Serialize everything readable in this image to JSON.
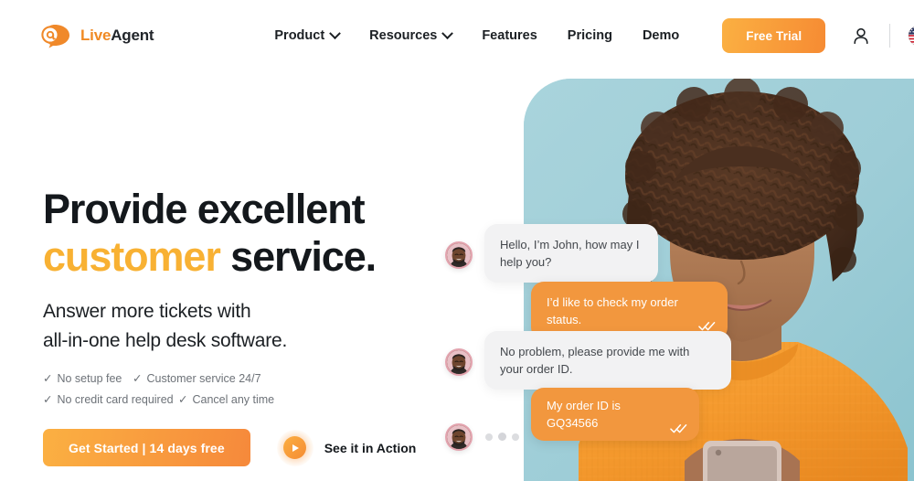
{
  "brand": {
    "logo_icon": "at-speech-bubble-icon",
    "name_primary": "Live",
    "name_secondary": "Agent"
  },
  "header": {
    "nav": [
      {
        "label": "Product",
        "has_dropdown": true,
        "icon": "chevron-down-icon"
      },
      {
        "label": "Resources",
        "has_dropdown": true,
        "icon": "chevron-down-icon"
      },
      {
        "label": "Features",
        "has_dropdown": false,
        "icon": ""
      },
      {
        "label": "Pricing",
        "has_dropdown": false,
        "icon": ""
      },
      {
        "label": "Demo",
        "has_dropdown": false,
        "icon": ""
      }
    ],
    "free_trial_label": "Free Trial",
    "account_icon": "user-icon",
    "language": {
      "flag_icon": "us-flag-icon",
      "chevron_icon": "chevron-down-icon"
    }
  },
  "hero": {
    "headline_line1_a": "Provide excellent",
    "headline_line2_accent": "customer",
    "headline_line2_b": " service.",
    "subhead_line1": "Answer more tickets with",
    "subhead_line2": "all-in-one help desk software.",
    "perks": [
      {
        "tick": "✓",
        "label": "No setup fee"
      },
      {
        "tick": "✓",
        "label": "Customer service 24/7"
      },
      {
        "tick": "✓",
        "label": "No credit card required"
      },
      {
        "tick": "✓",
        "label": "Cancel any time"
      }
    ],
    "cta_primary": "Get Started | 14 days free",
    "cta_secondary": "See it in Action",
    "play_icon": "play-icon",
    "image_alt": "woman-with-curly-hair-in-orange-sweater-holding-phone"
  },
  "chat": {
    "messages": [
      {
        "from": "agent",
        "text": "Hello, I’m John, how may I help you?",
        "avatar_icon": "agent-avatar",
        "read_receipt": false
      },
      {
        "from": "user",
        "text": "I’d like to check my order status.",
        "read_receipt": true,
        "receipt_icon": "double-check-icon"
      },
      {
        "from": "agent",
        "text": "No problem, please provide me with your order ID.",
        "avatar_icon": "agent-avatar",
        "read_receipt": false
      },
      {
        "from": "user",
        "text": "My order ID is GQ34566",
        "read_receipt": true,
        "receipt_icon": "double-check-icon"
      },
      {
        "from": "agent",
        "text": "",
        "avatar_icon": "agent-avatar",
        "typing": true,
        "typing_icon": "typing-dots-icon"
      }
    ]
  },
  "colors": {
    "brand_orange": "#F08A24",
    "accent_yellow": "#F8B133",
    "cta_gradient_start": "#FBB042",
    "cta_gradient_end": "#F6893B",
    "hero_bg": "#a6d2da",
    "user_bubble": "#F2973E",
    "agent_bubble": "#f2f2f3",
    "text_dark": "#14181c",
    "text_muted": "#6d7278",
    "avatar_ring": "#e3a3ae"
  }
}
